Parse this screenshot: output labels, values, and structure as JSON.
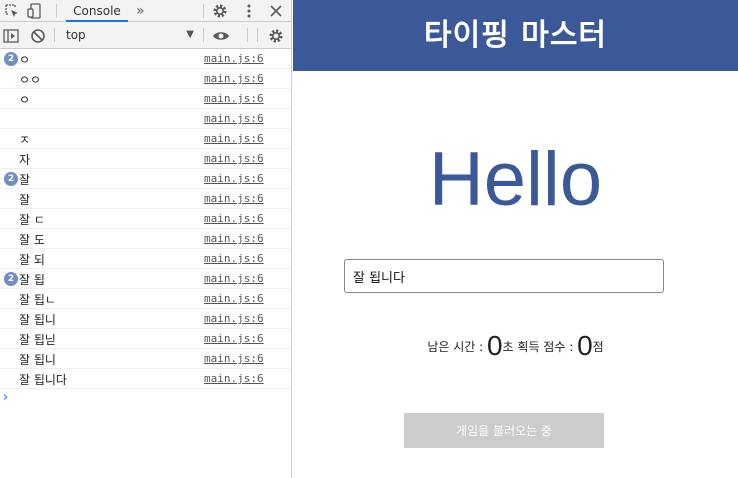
{
  "devtools": {
    "tabs": {
      "console": "Console",
      "more": "»"
    },
    "toolbar": {
      "context": "top"
    },
    "log": [
      {
        "count": "2",
        "message": "ㅇ",
        "source": "main.js:6"
      },
      {
        "count": "",
        "message": "ㅇㅇ",
        "source": "main.js:6"
      },
      {
        "count": "",
        "message": "ㅇ",
        "source": "main.js:6"
      },
      {
        "count": "",
        "message": "",
        "source": "main.js:6"
      },
      {
        "count": "",
        "message": "ㅈ",
        "source": "main.js:6"
      },
      {
        "count": "",
        "message": "자",
        "source": "main.js:6"
      },
      {
        "count": "2",
        "message": "잘",
        "source": "main.js:6"
      },
      {
        "count": "",
        "message": "잘",
        "source": "main.js:6"
      },
      {
        "count": "",
        "message": "잘 ㄷ",
        "source": "main.js:6"
      },
      {
        "count": "",
        "message": "잘 도",
        "source": "main.js:6"
      },
      {
        "count": "",
        "message": "잘 되",
        "source": "main.js:6"
      },
      {
        "count": "2",
        "message": "잘 됩",
        "source": "main.js:6"
      },
      {
        "count": "",
        "message": "잘 됩ㄴ",
        "source": "main.js:6"
      },
      {
        "count": "",
        "message": "잘 됩니",
        "source": "main.js:6"
      },
      {
        "count": "",
        "message": "잘 됩닏",
        "source": "main.js:6"
      },
      {
        "count": "",
        "message": "잘 됩니",
        "source": "main.js:6"
      },
      {
        "count": "",
        "message": "잘 됩니다",
        "source": "main.js:6"
      }
    ],
    "prompt": "›"
  },
  "app": {
    "title": "타이핑 마스터",
    "word": "Hello",
    "input_value": "잘 됩니다",
    "stats": {
      "time_label": "남은 시간 : ",
      "time_value": "0",
      "time_unit": "초",
      "score_label": " 획득 점수 : ",
      "score_value": "0",
      "score_unit": "점"
    },
    "button_label": "게임을 불러오는 중"
  },
  "icons": {
    "inspect": "inspect-element-icon",
    "device": "device-toolbar-icon",
    "settings": "gear-icon",
    "menu": "kebab-menu-icon",
    "close": "close-icon",
    "sidebar": "sidebar-toggle-icon",
    "clear": "clear-console-icon",
    "eye": "live-expression-icon"
  },
  "colors": {
    "header": "#3b5998",
    "word": "#3b5998",
    "badge": "#6f8fc0",
    "button_disabled": "#cccccc"
  }
}
